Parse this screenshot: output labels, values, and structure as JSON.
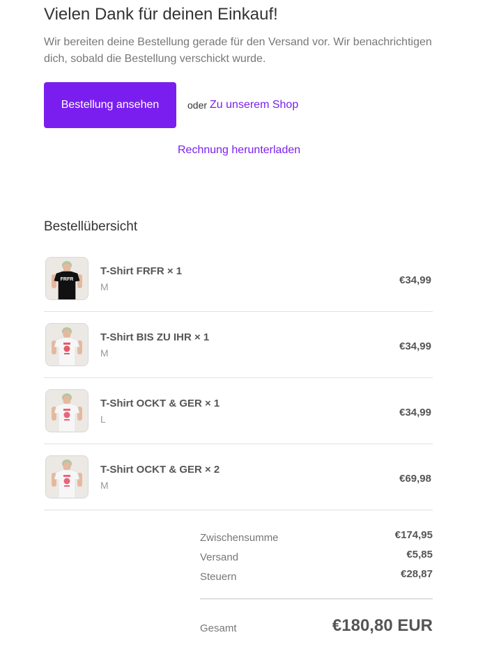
{
  "page": {
    "title": "Vielen Dank für deinen Einkauf!",
    "intro": "Wir bereiten deine Bestellung gerade für den Versand vor. Wir benachrichtigen dich, sobald die Bestellung verschickt wurde."
  },
  "actions": {
    "view_order_label": "Bestellung ansehen",
    "or_text": "oder",
    "shop_link_label": "Zu unserem Shop",
    "invoice_link_label": "Rechnung herunterladen"
  },
  "summary": {
    "title": "Bestellübersicht",
    "items": [
      {
        "name": "T-Shirt FRFR × 1",
        "variant": "M",
        "price": "€34,99",
        "shirt_color": "#111111",
        "print_text": "FRFR",
        "print_color": "#ffffff"
      },
      {
        "name": "T-Shirt BIS ZU IHR × 1",
        "variant": "M",
        "price": "€34,99",
        "shirt_color": "#f6f6f6",
        "print_text": "",
        "print_color": "#e35a6a"
      },
      {
        "name": "T-Shirt OCKT & GER × 1",
        "variant": "L",
        "price": "€34,99",
        "shirt_color": "#f6f6f6",
        "print_text": "",
        "print_color": "#e8667a"
      },
      {
        "name": "T-Shirt OCKT & GER × 2",
        "variant": "M",
        "price": "€69,98",
        "shirt_color": "#f6f6f6",
        "print_text": "",
        "print_color": "#e8667a"
      }
    ]
  },
  "totals": {
    "subtotal_label": "Zwischensumme",
    "subtotal_value": "€174,95",
    "shipping_label": "Versand",
    "shipping_value": "€5,85",
    "taxes_label": "Steuern",
    "taxes_value": "€28,87",
    "total_label": "Gesamt",
    "total_value": "€180,80 EUR"
  },
  "colors": {
    "accent": "#7a1ef0",
    "text": "#333333",
    "muted": "#777777",
    "divider": "#e1e1e1"
  }
}
